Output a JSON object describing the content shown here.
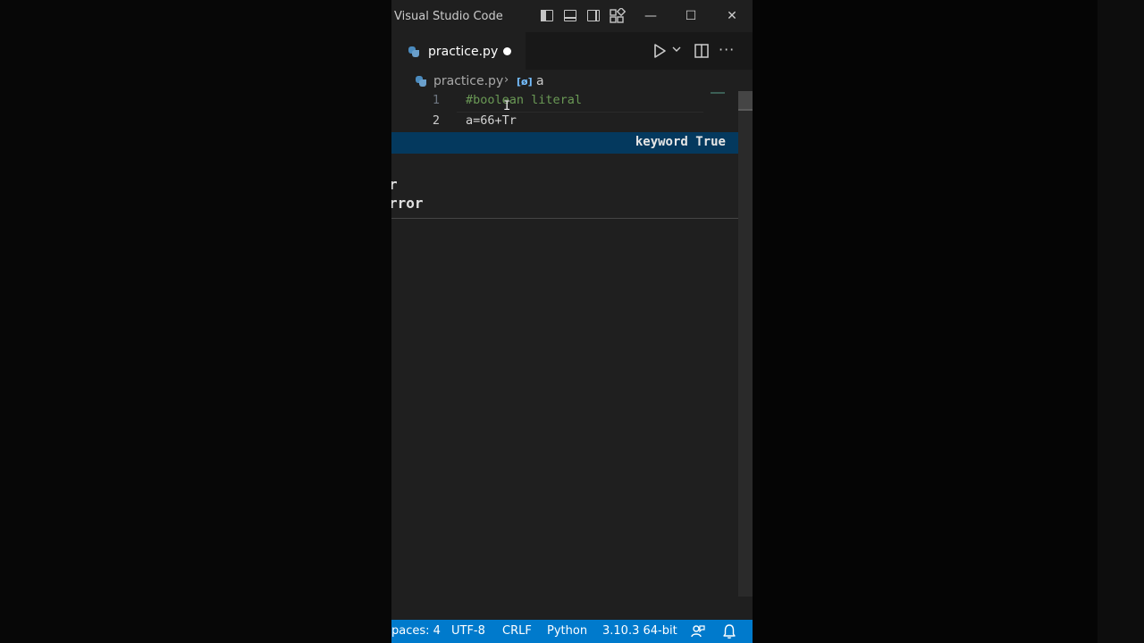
{
  "titlebar": {
    "title": "Visual Studio Code",
    "layout_icons": [
      "toggle-primary-sidebar-icon",
      "toggle-panel-icon",
      "toggle-secondary-sidebar-icon",
      "customize-layout-icon"
    ],
    "window_controls": {
      "minimize": "—",
      "maximize": "☐",
      "close": "✕"
    }
  },
  "tabs": [
    {
      "label": "practice.py",
      "icon": "python-file-icon",
      "dirty": true
    }
  ],
  "editor_actions": {
    "run": "run-icon",
    "split": "split-editor-icon",
    "more": "···"
  },
  "breadcrumb": {
    "file": "practice.py",
    "separator": "›",
    "symbol_icon": "[ø]",
    "symbol": "a"
  },
  "editor": {
    "lines": [
      {
        "number": "1",
        "text": "#boolean literal",
        "kind": "comment"
      },
      {
        "number": "2",
        "text": "a=66+Tr",
        "kind": "code"
      }
    ],
    "cursor": "I"
  },
  "suggest": {
    "selected_detail": "keyword True",
    "items": [
      "r",
      "rror"
    ]
  },
  "statusbar": {
    "spaces": "paces: 4",
    "encoding": "UTF-8",
    "eol": "CRLF",
    "language": "Python",
    "interpreter": "3.10.3 64-bit",
    "icons": [
      "feedback-icon",
      "bell-icon"
    ]
  },
  "colors": {
    "accent_status": "#007acc",
    "suggest_selected": "#04395e",
    "comment": "#6a9955"
  }
}
